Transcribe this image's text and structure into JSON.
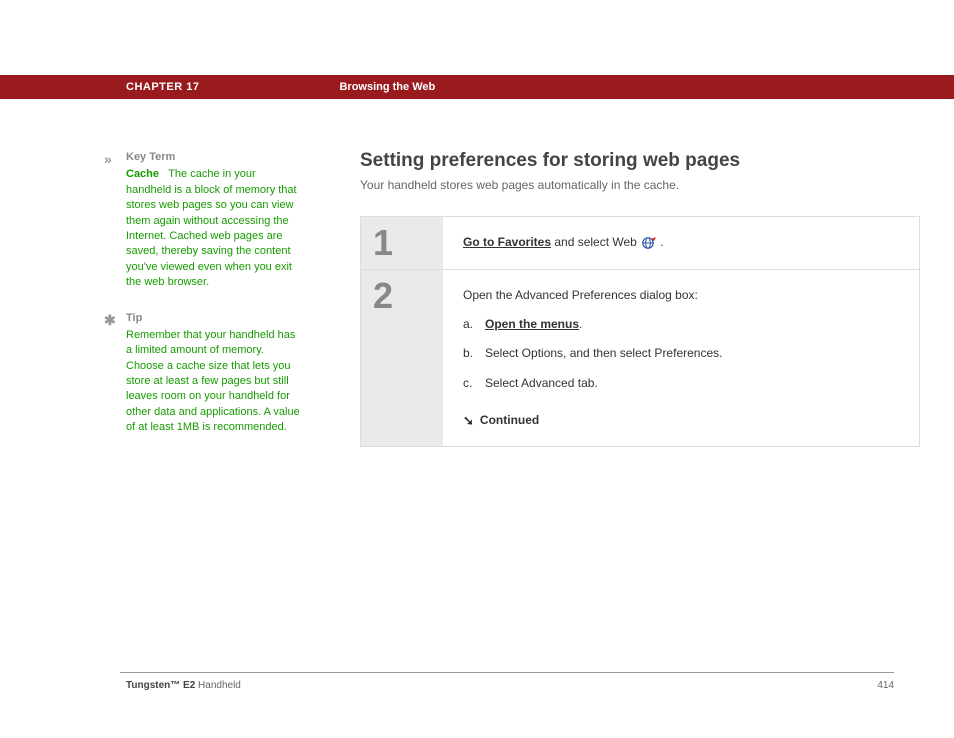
{
  "header": {
    "chapter": "CHAPTER 17",
    "title": "Browsing the Web"
  },
  "sidebar": {
    "keyterm": {
      "label": "Key Term",
      "term": "Cache",
      "text": "The cache in your handheld is a block of memory that stores web pages so you can view them again without accessing the Internet. Cached web pages are saved, thereby saving the content you've viewed even when you exit the web browser."
    },
    "tip": {
      "label": "Tip",
      "text": "Remember that your handheld has a limited amount of memory. Choose a cache size that lets you store at least a few pages but still leaves room on your handheld for other data and applications. A value of at least 1MB is recommended."
    }
  },
  "main": {
    "heading": "Setting preferences for storing web pages",
    "subtext": "Your handheld stores web pages automatically in the cache.",
    "step1": {
      "num": "1",
      "link": "Go to Favorites",
      "rest": " and select Web ",
      "period": "."
    },
    "step2": {
      "num": "2",
      "intro": "Open the Advanced Preferences dialog box:",
      "a_letter": "a.",
      "a_link": "Open the menus",
      "a_period": ".",
      "b_letter": "b.",
      "b_text": "Select Options, and then select Preferences.",
      "c_letter": "c.",
      "c_text": "Select Advanced tab.",
      "continued": "Continued"
    }
  },
  "footer": {
    "product_bold": "Tungsten™ E2",
    "product_rest": " Handheld",
    "page": "414"
  }
}
